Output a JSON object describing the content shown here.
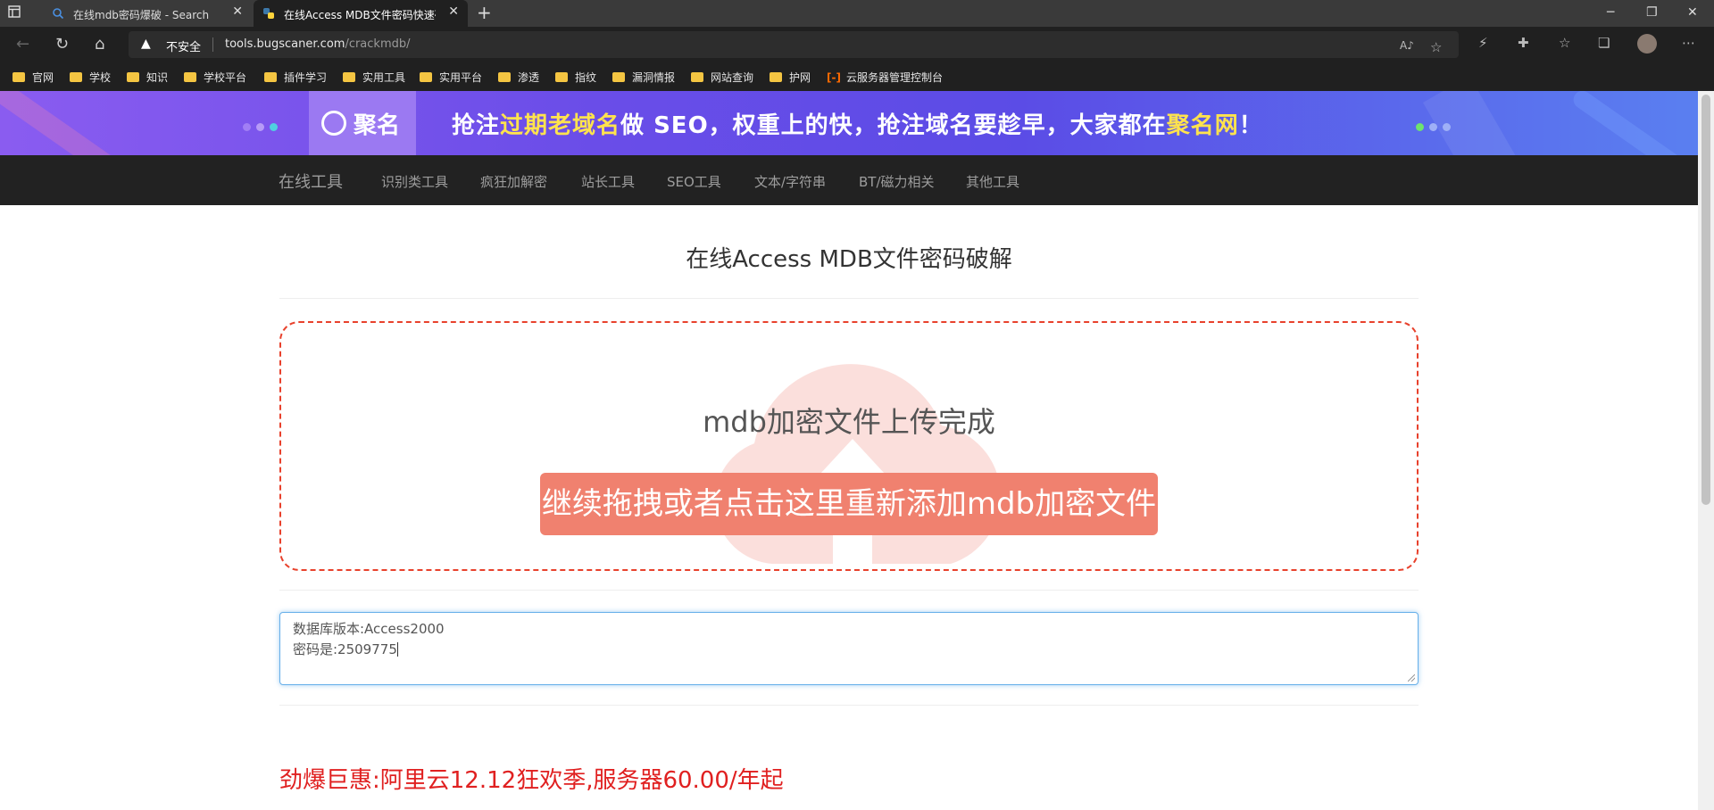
{
  "browser": {
    "tabs": [
      {
        "title": "在线mdb密码爆破 - Search",
        "icon": "search-icon"
      },
      {
        "title": "在线Access MDB文件密码快速破解",
        "icon": "python-favicon-icon"
      }
    ],
    "address": {
      "security_label": "不安全",
      "host": "tools.bugscaner.com",
      "path": "/crackmdb/"
    },
    "bookmarks": [
      "官网",
      "学校",
      "知识",
      "学校平台",
      "插件学习",
      "实用工具",
      "实用平台",
      "渗透",
      "指纹",
      "漏洞情报",
      "网站查询",
      "护网",
      "云服务器管理控制台"
    ]
  },
  "banner": {
    "logo_text": "聚名",
    "slogan_parts": [
      "抢注",
      "过期老域名",
      "做 SEO，权重上的快，抢注域名要趁早，大家都在",
      "聚名网",
      "！"
    ]
  },
  "nav": {
    "brand": "在线工具",
    "items": [
      "识别类工具",
      "疯狂加解密",
      "站长工具",
      "SEO工具",
      "文本/字符串",
      "BT/磁力相关",
      "其他工具"
    ]
  },
  "main": {
    "title": "在线Access MDB文件密码破解",
    "upload_status": "mdb加密文件上传完成",
    "upload_button": "继续拖拽或者点击这里重新添加mdb加密文件",
    "result_lines": [
      "数据库版本:Access2000",
      "密码是:2509775"
    ],
    "promo": "劲爆巨惠:阿里云12.12狂欢季,服务器60.00/年起"
  },
  "colors": {
    "accent_red": "#e8412c",
    "button_red": "#f0816f",
    "nav_bg": "#222222",
    "banner_purple": "#6a4de8",
    "banner_yellow": "#ffe34d",
    "promo_red": "#e02020"
  }
}
